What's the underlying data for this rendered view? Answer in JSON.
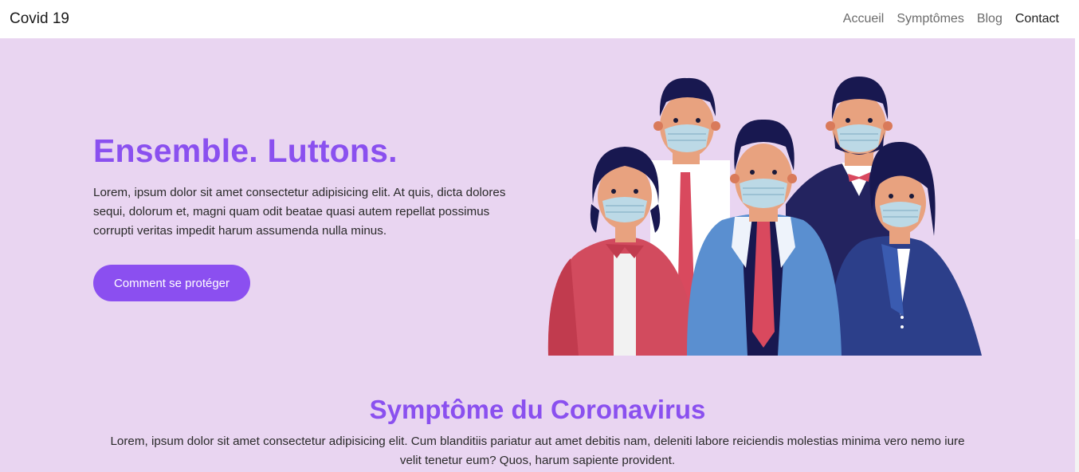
{
  "navbar": {
    "brand": "Covid 19",
    "links": [
      {
        "label": "Accueil"
      },
      {
        "label": "Symptômes"
      },
      {
        "label": "Blog"
      },
      {
        "label": "Contact"
      }
    ]
  },
  "hero": {
    "title": "Ensemble. Luttons.",
    "body": "Lorem, ipsum dolor sit amet consectetur adipisicing elit. At quis, dicta dolores sequi, dolorum et, magni quam odit beatae quasi autem repellat possimus corrupti veritas impedit harum assumenda nulla minus.",
    "cta_label": "Comment se protéger"
  },
  "symptoms": {
    "title": "Symptôme du Coronavirus",
    "body": "Lorem, ipsum dolor sit amet consectetur adipisicing elit. Cum blanditiis pariatur aut amet debitis nam, deleniti labore reiciendis molestias minima vero nemo iure velit tenetur eum? Quos, harum sapiente provident."
  },
  "colors": {
    "accent": "#8b4ff0",
    "background": "#e9d5f1",
    "navbar_bg": "#ffffff"
  }
}
